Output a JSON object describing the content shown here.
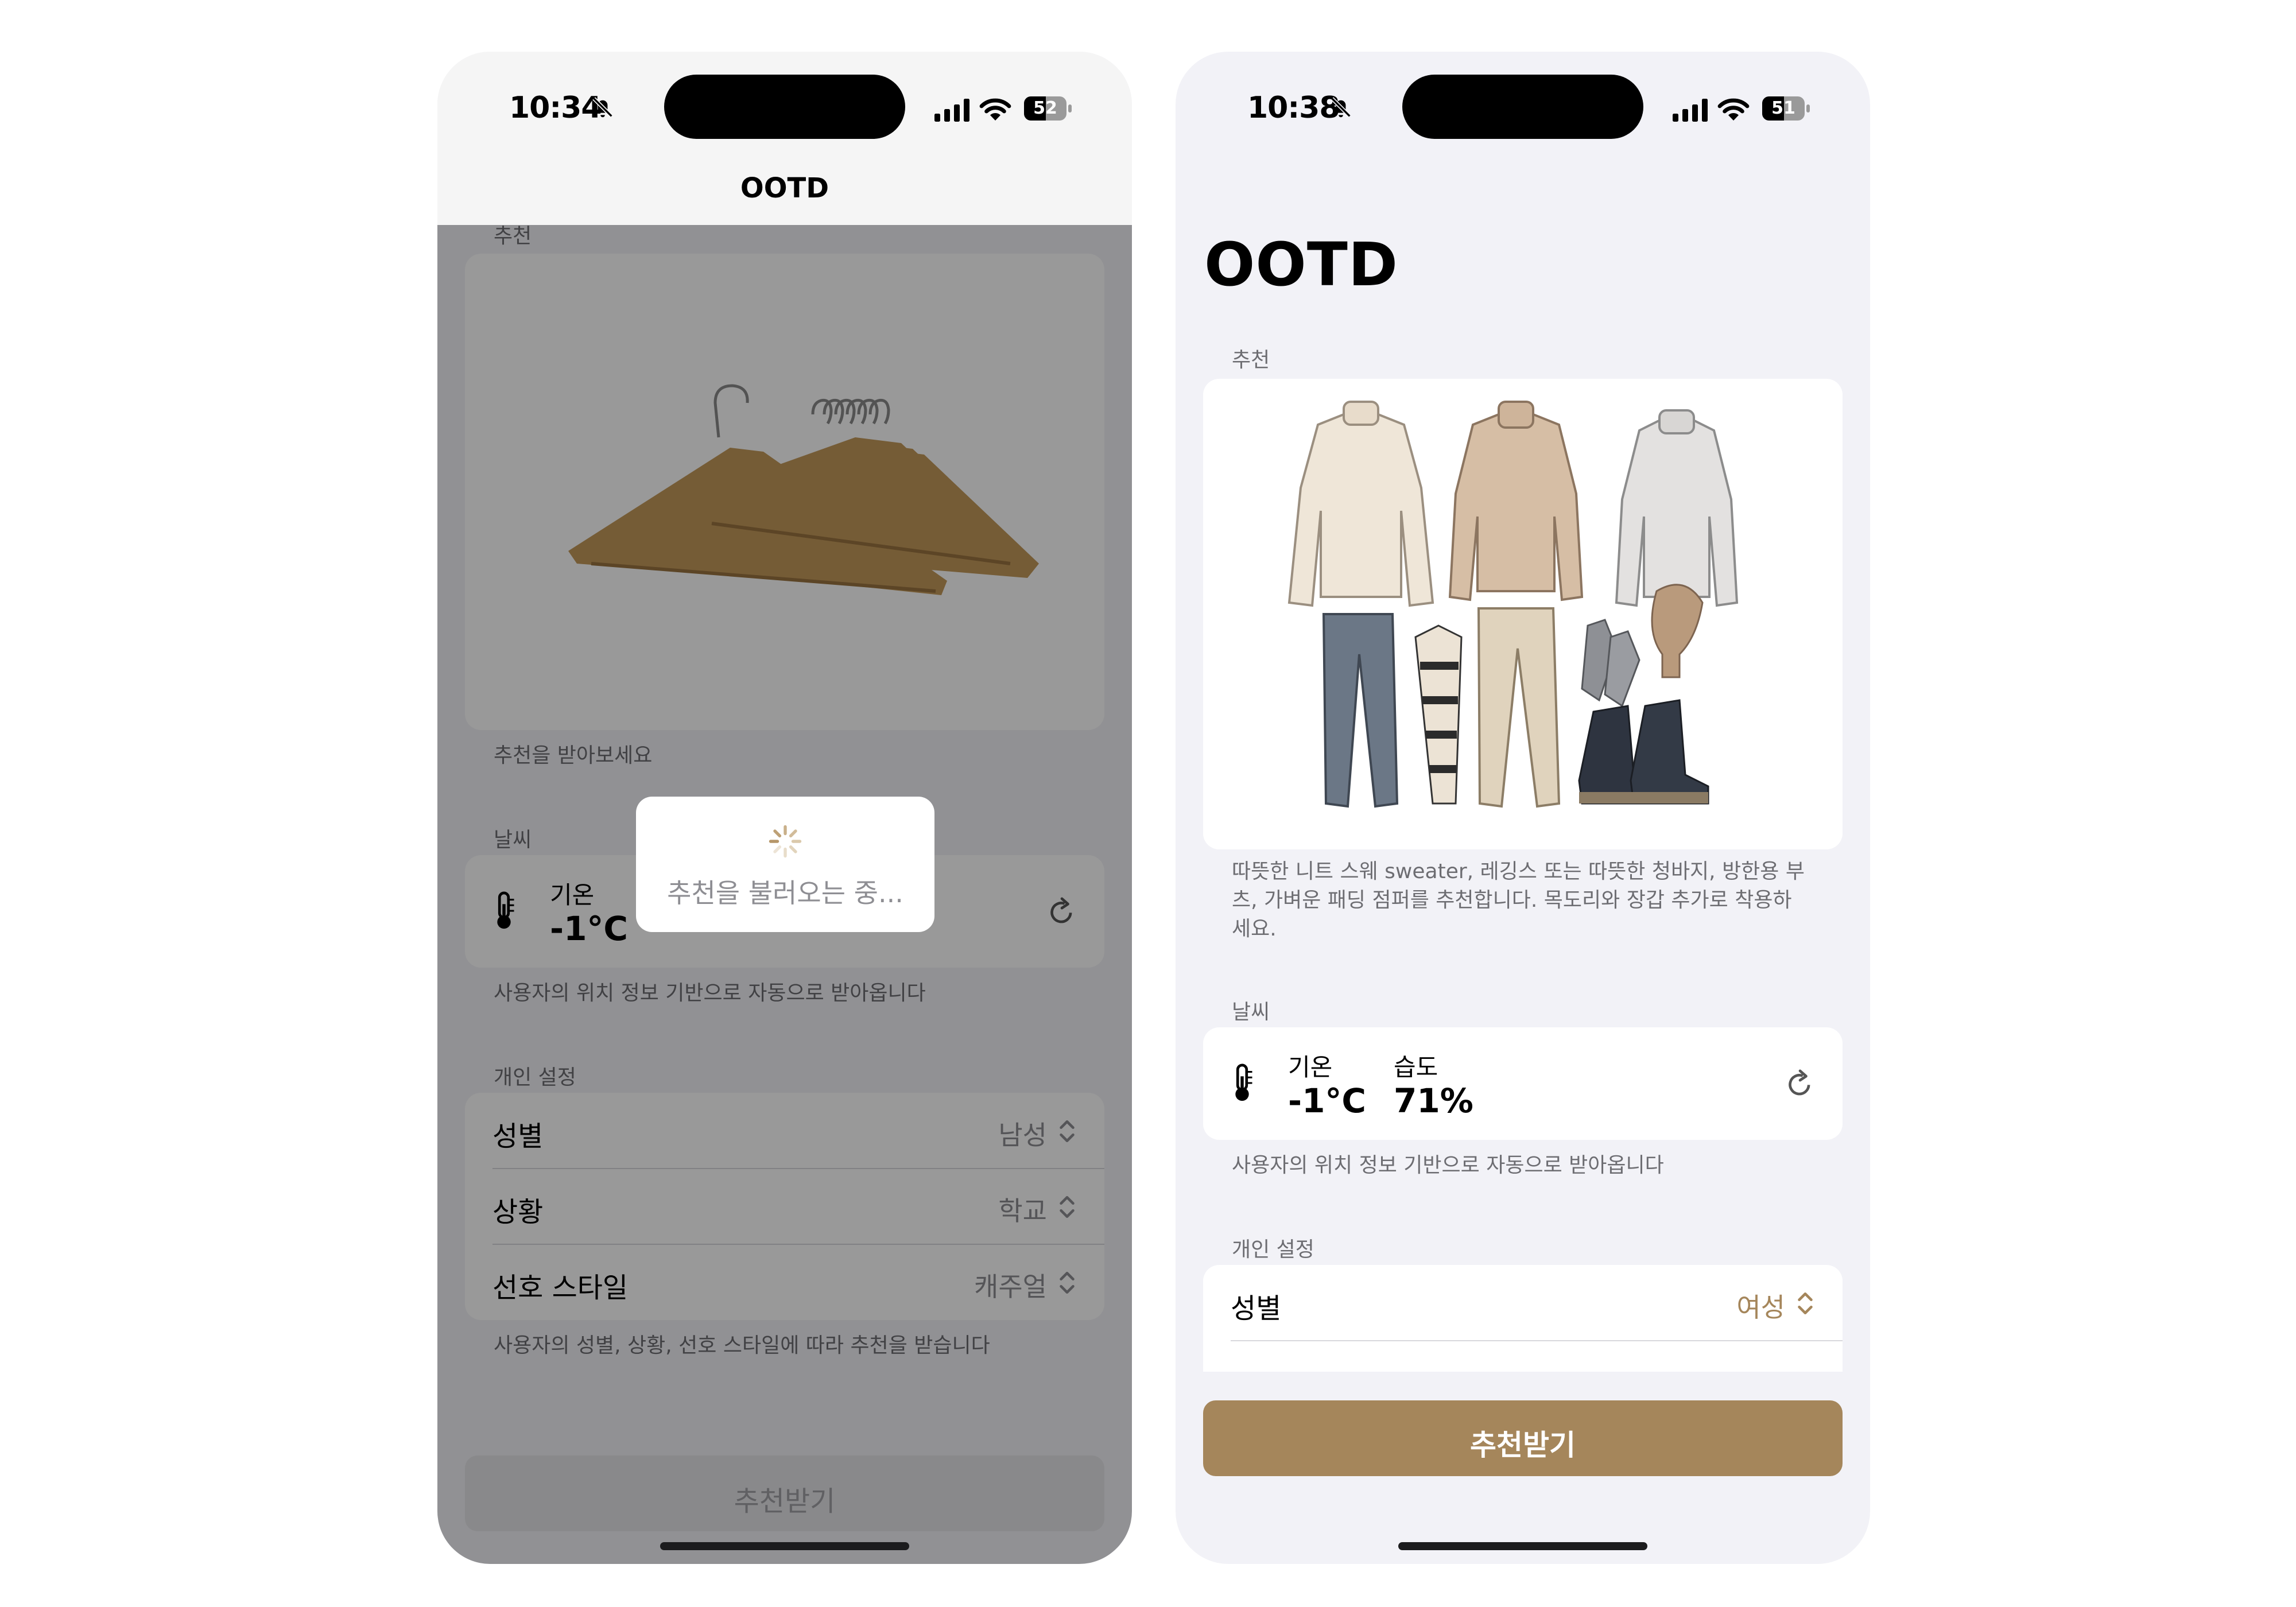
{
  "left_screen": {
    "status": {
      "time": "10:34",
      "battery": "52"
    },
    "nav_title": "OOTD",
    "recommend_section_label": "추천",
    "recommend_caption": "추천을 받아보세요",
    "weather_section_label": "날씨",
    "temp_label": "기온",
    "temp_value": "-1°C",
    "weather_footnote": "사용자의 위치 정보 기반으로 자동으로 받아옵니다",
    "settings_section_label": "개인 설정",
    "settings": [
      {
        "label": "성별",
        "value": "남성"
      },
      {
        "label": "상황",
        "value": "학교"
      },
      {
        "label": "선호 스타일",
        "value": "캐주얼"
      }
    ],
    "settings_footnote": "사용자의 성별, 상황, 선호 스타일에 따라 추천을 받습니다",
    "button_label": "추천받기",
    "loading_text": "추천을 불러오는 중..."
  },
  "right_screen": {
    "status": {
      "time": "10:38",
      "battery": "51"
    },
    "title": "OOTD",
    "recommend_section_label": "추천",
    "recommend_text": "따뜻한 니트 스웨 sweater, 레깅스 또는 따뜻한 청바지, 방한용 부츠, 가벼운 패딩 점퍼를 추천합니다. 목도리와 장갑 추가로 착용하세요.",
    "weather_section_label": "날씨",
    "temp_label": "기온",
    "temp_value": "-1°C",
    "humidity_label": "습도",
    "humidity_value": "71%",
    "weather_footnote": "사용자의 위치 정보 기반으로 자동으로 받아옵니다",
    "settings_section_label": "개인 설정",
    "settings": [
      {
        "label": "성별",
        "value": "여성"
      }
    ],
    "button_label": "추천받기"
  },
  "colors": {
    "accent": "#a5865b",
    "background": "#f2f2f7",
    "secondary_text": "#6d6d72"
  }
}
